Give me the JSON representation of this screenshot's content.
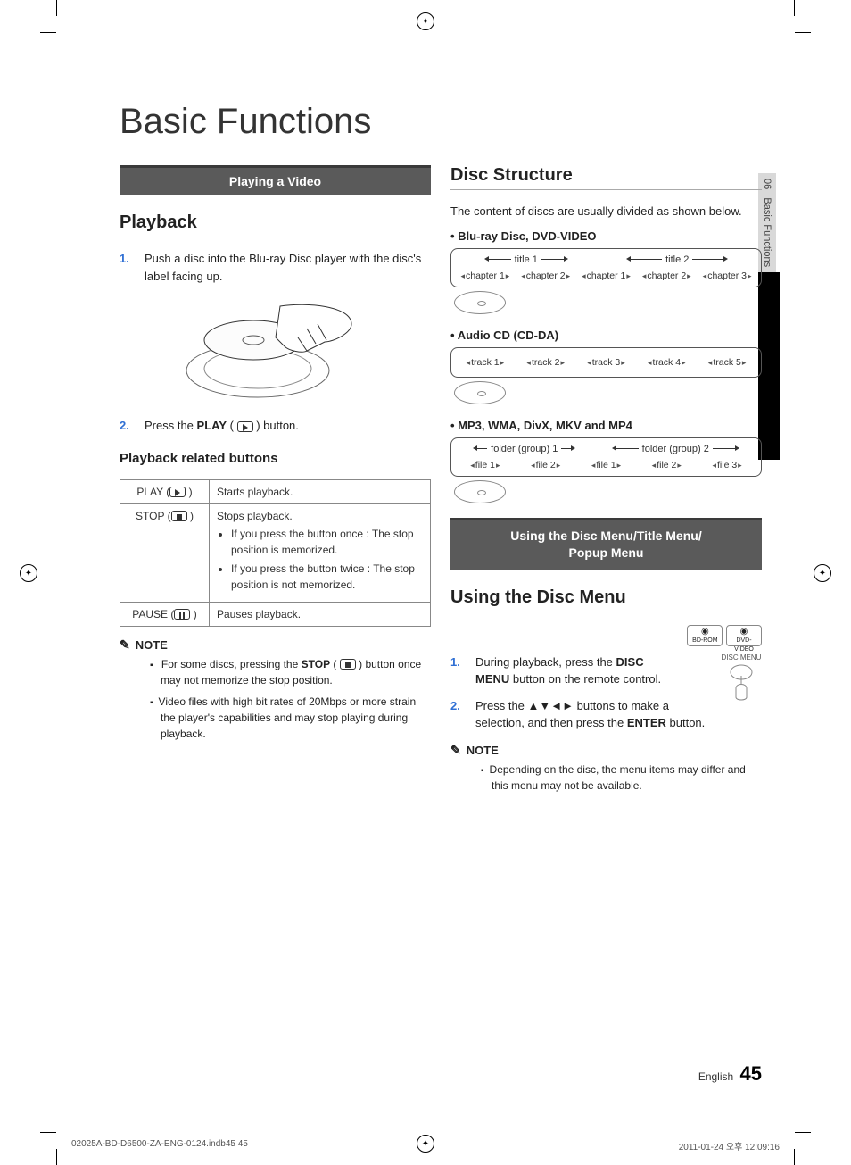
{
  "crop": {},
  "side_tab": {
    "chapter_num": "06",
    "chapter_name": "Basic Functions"
  },
  "main_title": "Basic Functions",
  "left": {
    "banner": "Playing a Video",
    "heading": "Playback",
    "step1": {
      "num": "1.",
      "text": "Push a disc into the Blu-ray Disc player with the disc's label facing up."
    },
    "step2": {
      "num": "2.",
      "text_a": "Press the ",
      "bold": "PLAY",
      "text_b": " button."
    },
    "table_heading": "Playback related buttons",
    "table": {
      "play": {
        "label": "PLAY (",
        "desc": "Starts playback."
      },
      "stop": {
        "label": "STOP (",
        "desc_head": "Stops playback.",
        "b1": "If you press the button once : The stop position is memorized.",
        "b2": "If you press the button twice : The stop position is not memorized."
      },
      "pause": {
        "label": "PAUSE (",
        "desc": "Pauses playback."
      }
    },
    "note_label": "NOTE",
    "notes": {
      "n1a": "For some discs, pressing the ",
      "n1b": "STOP",
      "n1c": " button once may not memorize the stop position.",
      "n2": "Video files with high bit rates of 20Mbps or more strain the player's capabilities and may stop playing during playback."
    }
  },
  "right": {
    "heading1": "Disc Structure",
    "intro": "The content of discs are usually divided as shown below.",
    "ds1": {
      "label": "Blu-ray Disc, DVD-VIDEO",
      "titles": [
        "title 1",
        "title 2"
      ],
      "chapters": [
        "chapter 1",
        "chapter 2",
        "chapter 1",
        "chapter 2",
        "chapter 3"
      ]
    },
    "ds2": {
      "label": "Audio CD (CD-DA)",
      "tracks": [
        "track 1",
        "track 2",
        "track 3",
        "track 4",
        "track 5"
      ]
    },
    "ds3": {
      "label": "MP3, WMA, DivX, MKV and MP4",
      "folders": [
        "folder (group) 1",
        "folder (group) 2"
      ],
      "files": [
        "file 1",
        "file 2",
        "file 1",
        "file 2",
        "file 3"
      ]
    },
    "banner2": "Using the Disc Menu/Title Menu/\nPopup Menu",
    "heading2": "Using the Disc Menu",
    "badges": {
      "b1": "BD-ROM",
      "b2": "DVD-VIDEO"
    },
    "remote_label": "DISC MENU",
    "step1": {
      "num": "1.",
      "text_a": "During playback, press the ",
      "bold": "DISC MENU",
      "text_b": " button on the remote control."
    },
    "step2": {
      "num": "2.",
      "text_a": "Press the ▲▼◄► buttons to make a selection, and then press the ",
      "bold": "ENTER",
      "text_b": " button."
    },
    "note_label": "NOTE",
    "note1": "Depending on the disc, the menu items may differ and this menu may not be available."
  },
  "footer": {
    "lang": "English",
    "page": "45"
  },
  "printer": {
    "left": "02025A-BD-D6500-ZA-ENG-0124.indb45   45",
    "right": "2011-01-24   오후 12:09:16"
  }
}
